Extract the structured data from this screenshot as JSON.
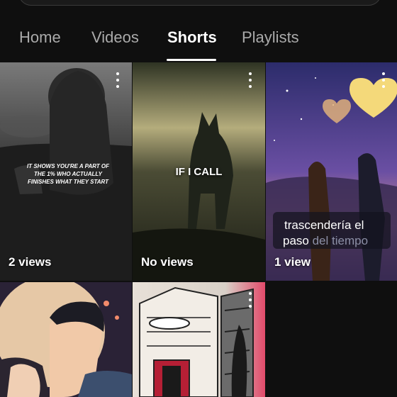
{
  "tabs": [
    {
      "label": "Home",
      "active": false
    },
    {
      "label": "Videos",
      "active": false
    },
    {
      "label": "Shorts",
      "active": true
    },
    {
      "label": "Playlists",
      "active": false
    }
  ],
  "shorts": [
    {
      "views": "2 views",
      "overlay_text": "IT SHOWS YOU'RE A PART OF THE 1% WHO ACTUALLY FINISHES WHAT THEY START",
      "scene": "lion-cub-monochrome"
    },
    {
      "views": "No views",
      "overlay_text": "IF I CALL",
      "scene": "wolf-on-rock"
    },
    {
      "views": "1 view",
      "caption_line1": "trascendería el",
      "caption_line2_bright": "paso",
      "caption_line2_dim": " del tiempo",
      "scene": "couple-under-hearts"
    },
    {
      "views": "",
      "scene": "anime-couple-moon"
    },
    {
      "views": "",
      "scene": "manga-building"
    }
  ],
  "icons": {
    "more": "more-vert-icon"
  },
  "colors": {
    "background": "#0f0f0f",
    "tab_inactive": "#aaaaaa",
    "tab_active": "#ffffff"
  }
}
